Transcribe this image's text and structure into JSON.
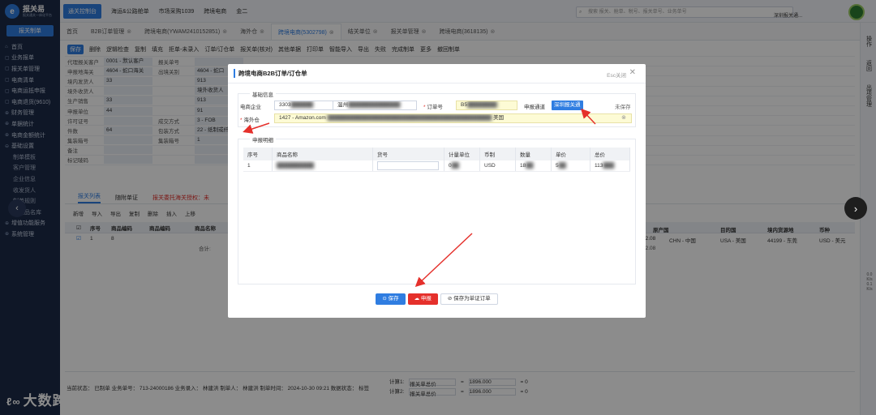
{
  "sidebar": {
    "logo_title": "报关易",
    "logo_sub": "报关通关一体化平台",
    "declare_button": "报关制单",
    "items": [
      {
        "icon": "⌂",
        "label": "首页"
      },
      {
        "icon": "▢",
        "label": "业务报单"
      },
      {
        "icon": "▢",
        "label": "报关单管理"
      },
      {
        "icon": "▢",
        "label": "电商清单"
      },
      {
        "icon": "▢",
        "label": "电商运抵申报"
      },
      {
        "icon": "▢",
        "label": "电商退货(9610)"
      },
      {
        "icon": "⊕",
        "label": "财务管理"
      },
      {
        "icon": "⊕",
        "label": "单据统计"
      },
      {
        "icon": "⊕",
        "label": "电商金额统计"
      },
      {
        "icon": "⊖",
        "label": "基础设置"
      }
    ],
    "sub_items": [
      "制单模板",
      "客户管理",
      "企业信息",
      "收发货人",
      "制单规则",
      "历史品名库"
    ],
    "items_after": [
      {
        "icon": "⊕",
        "label": "增值功能服务"
      },
      {
        "icon": "⊕",
        "label": "系统管理"
      }
    ],
    "watermark": "大数跨境",
    "watermark_mark": "ℓ∞"
  },
  "topbar": {
    "console_button": "通关控制台",
    "links": [
      "海运&公路舱单",
      "市场采购1039",
      "跨境电商",
      "金二"
    ],
    "search_placeholder": "搜索 报关、舱单、税号、报关单号、业务单号",
    "user_text": "深圳报关通...",
    "user_initials": "宝"
  },
  "tabs": [
    {
      "label": "首页",
      "active": false,
      "close": false
    },
    {
      "label": "B2B订单管理",
      "active": false,
      "close": true
    },
    {
      "label": "跨境电商(YWAM2410152851)",
      "active": false,
      "close": true
    },
    {
      "label": "海外仓",
      "active": false,
      "close": true
    },
    {
      "label": "跨境电商(5302798)",
      "active": true,
      "close": true
    },
    {
      "label": "结关单位",
      "active": false,
      "close": true
    },
    {
      "label": "报关单管理",
      "active": false,
      "close": true
    },
    {
      "label": "跨境电商(3618135)",
      "active": false,
      "close": true
    }
  ],
  "right_rail": {
    "labels": [
      "操作",
      "返回",
      "出项管理"
    ],
    "status": [
      "0.0",
      "K/s",
      "0.1",
      "K/s"
    ]
  },
  "background_form": {
    "toolbar": [
      {
        "label": "保存",
        "primary": true
      },
      {
        "label": "删除",
        "primary": false
      },
      {
        "label": "逻辑检查",
        "primary": false
      },
      {
        "label": "复制",
        "primary": false
      },
      {
        "label": "填充",
        "primary": false
      },
      {
        "label": "拒单-未录入",
        "primary": false
      },
      {
        "label": "订单/订仓单",
        "primary": false
      },
      {
        "label": "报关单(核对)",
        "primary": false
      },
      {
        "label": "其他单据",
        "primary": false
      },
      {
        "label": "打印单",
        "primary": false
      },
      {
        "label": "智能导入",
        "primary": false
      },
      {
        "label": "导出",
        "primary": false
      },
      {
        "label": "失败",
        "primary": false
      },
      {
        "label": "完成制单",
        "primary": false
      },
      {
        "label": "更多",
        "primary": false
      },
      {
        "label": "撤回制单",
        "primary": false
      }
    ],
    "rows": [
      {
        "label": "代理报关客户",
        "value": "0001 - 默认客户",
        "label2": "报关单号",
        "value2": ""
      },
      {
        "label": "申报地海关",
        "value": "4604 - 蛇口海关",
        "label2": "出境关别",
        "value2": "4604 - 蛇口"
      },
      {
        "label": "境内发货人",
        "value": "33",
        "label2": "",
        "value2": "913"
      },
      {
        "label": "境外收货人",
        "value": "",
        "label2": "",
        "value2": "境外收货人"
      },
      {
        "label": "生产销售",
        "value": "33",
        "label2": "",
        "value2": "913"
      },
      {
        "label": "申报单位",
        "value": "44",
        "label2": "",
        "value2": "91"
      },
      {
        "label": "许可证号",
        "value": "",
        "label2": "成交方式",
        "value2": "3 - FOB"
      },
      {
        "label": "件数",
        "value": "64",
        "label2": "包装方式",
        "value2": "22 - 纸制或纤维板制"
      },
      {
        "label": "集装箱号",
        "value": "",
        "label2": "集装箱号",
        "value2": "1"
      },
      {
        "label": "备注",
        "value": "",
        "label2": "",
        "value2": ""
      },
      {
        "label": "标记唛码",
        "value": "",
        "label2": "",
        "value2": ""
      }
    ],
    "sub_tabs": [
      "报关列表",
      "随附单证",
      "报关委托海关授权：未"
    ],
    "sub_tools": [
      "新增",
      "导入",
      "导出",
      "复制",
      "删除",
      "插入",
      "上移"
    ],
    "grid_headers": [
      "序号",
      "商品编码",
      "商品编码",
      "商品名称"
    ],
    "grid_row": [
      "1",
      "8",
      "",
      ""
    ],
    "grid_sum": "合计:",
    "right_grid_headers": [
      "原产国",
      "目的国",
      "境内货源地",
      "币种"
    ],
    "right_grid_row": {
      "price": "22.08",
      "origin": "CHN - 中国",
      "dest": "USA - 美国",
      "source": "44199 - 东莞",
      "currency": "USD - 美元"
    },
    "right_grid_sum": "22.08",
    "status_line": "当前状态： 已制单 业务单号： 713-24000186 业务录入： 林建洪 制单人： 林建洪 制单时间： 2024-10-30 09:21 数据状态： 标签",
    "calc": [
      {
        "label": "计算1:",
        "select": "报关单总价",
        "op": "=",
        "value1": "1896.000",
        "eq": "=",
        "result": "0"
      },
      {
        "label": "计算2:",
        "select": "报关单总价",
        "op": "=",
        "value1": "1896.000",
        "eq": "=",
        "result": "0"
      }
    ]
  },
  "modal": {
    "title": "跨境电商B2B订单/订仓单",
    "esc_label": "Esc关闭",
    "basic_section": "基础信息",
    "company_label": "电商企业",
    "company_code": "3303",
    "company_name": "温州",
    "order_label": "订单号",
    "order_value": "B5",
    "channel_label": "申报通道",
    "channel_button": "深圳报关通",
    "unsaved": "未保存",
    "overseas_label": "海外仓",
    "overseas_value": "1427 - Amazon.com",
    "overseas_country": "美国",
    "detail_section": "申报明细",
    "table_headers": [
      "序号",
      "商品名称",
      "货号",
      "计量单位",
      "币制",
      "数量",
      "单价",
      "总价"
    ],
    "table_row": [
      "1",
      "",
      "",
      "0",
      "USD",
      "18",
      "5",
      "113"
    ],
    "buttons": {
      "save": "保存",
      "declare": "申报",
      "save_as_cert": "保存为单证订单"
    }
  },
  "colors": {
    "accent": "#2f7de1",
    "danger": "#e5302b",
    "sidebar": "#1c2a47",
    "highlight": "#fdfbd5"
  }
}
